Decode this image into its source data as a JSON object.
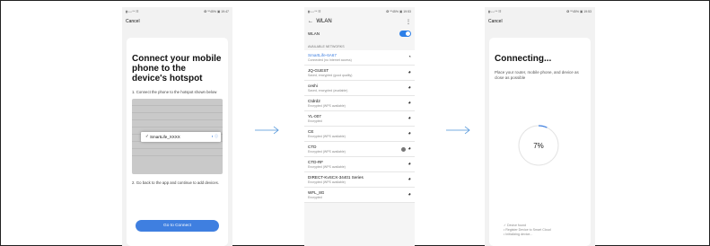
{
  "phone1": {
    "status_left": "▮◦ᵢₗ ᵢₗ ⁸⁶ ☷",
    "status_right": "✪ ⁰⁰45% ▣ 19:47",
    "cancel": "Cancel",
    "title": "Connect your mobile phone to the device's hotspot",
    "step1": "1. Connect the phone to the hotspot shown below",
    "hotspot_name": "SmartLife_XXXX",
    "step2": "2. Go back to the app and continue to add devices.",
    "button": "Go to Connect"
  },
  "phone2": {
    "status_left": "▮◦ᵢₗ ᵢₗ ⁸⁶ ☷",
    "status_right": "✪ ⁰⁰45% ▣ 19:53",
    "title": "WLAN",
    "wlan_label": "WLAN",
    "section": "AVAILABLE NETWORKS",
    "networks": [
      {
        "name": "SmartLife-6A67",
        "status": "Connected (no Internet access)",
        "active": true
      },
      {
        "name": "JQ-GUEST",
        "status": "Saved, encrypted (good quality)"
      },
      {
        "name": "ceshi",
        "status": "Saved, encrypted (available)"
      },
      {
        "name": "Ctdrd2",
        "status": "Encrypted (WPS available)"
      },
      {
        "name": "YL-007",
        "status": "Encrypted"
      },
      {
        "name": "CE",
        "status": "Encrypted (WPS available)"
      },
      {
        "name": "CTD",
        "status": "Encrypted (WPS available)",
        "info": true
      },
      {
        "name": "CTD-RF",
        "status": "Encrypted (WPS available)"
      },
      {
        "name": "DIRECT-KvSCX-34401 Series",
        "status": "Encrypted (WPS available)"
      },
      {
        "name": "WFL_8G",
        "status": "Encrypted"
      }
    ]
  },
  "phone3": {
    "status_left": "▮◦ᵢₗ ᵢₗ ⁸⁶ ☷",
    "status_right": "✪ ⁰⁰45% ▣ 19:53",
    "cancel": "Cancel",
    "title": "Connecting...",
    "desc": "Place your router, mobile phone, and device as close as possible",
    "percent": "7%",
    "progress": 0.07,
    "steps": [
      "✓ Device found",
      "• Register Device to Smart Cloud",
      "• Initializing device..."
    ]
  },
  "colors": {
    "accent": "#3f7fe0",
    "arrow": "#4a90d9"
  }
}
